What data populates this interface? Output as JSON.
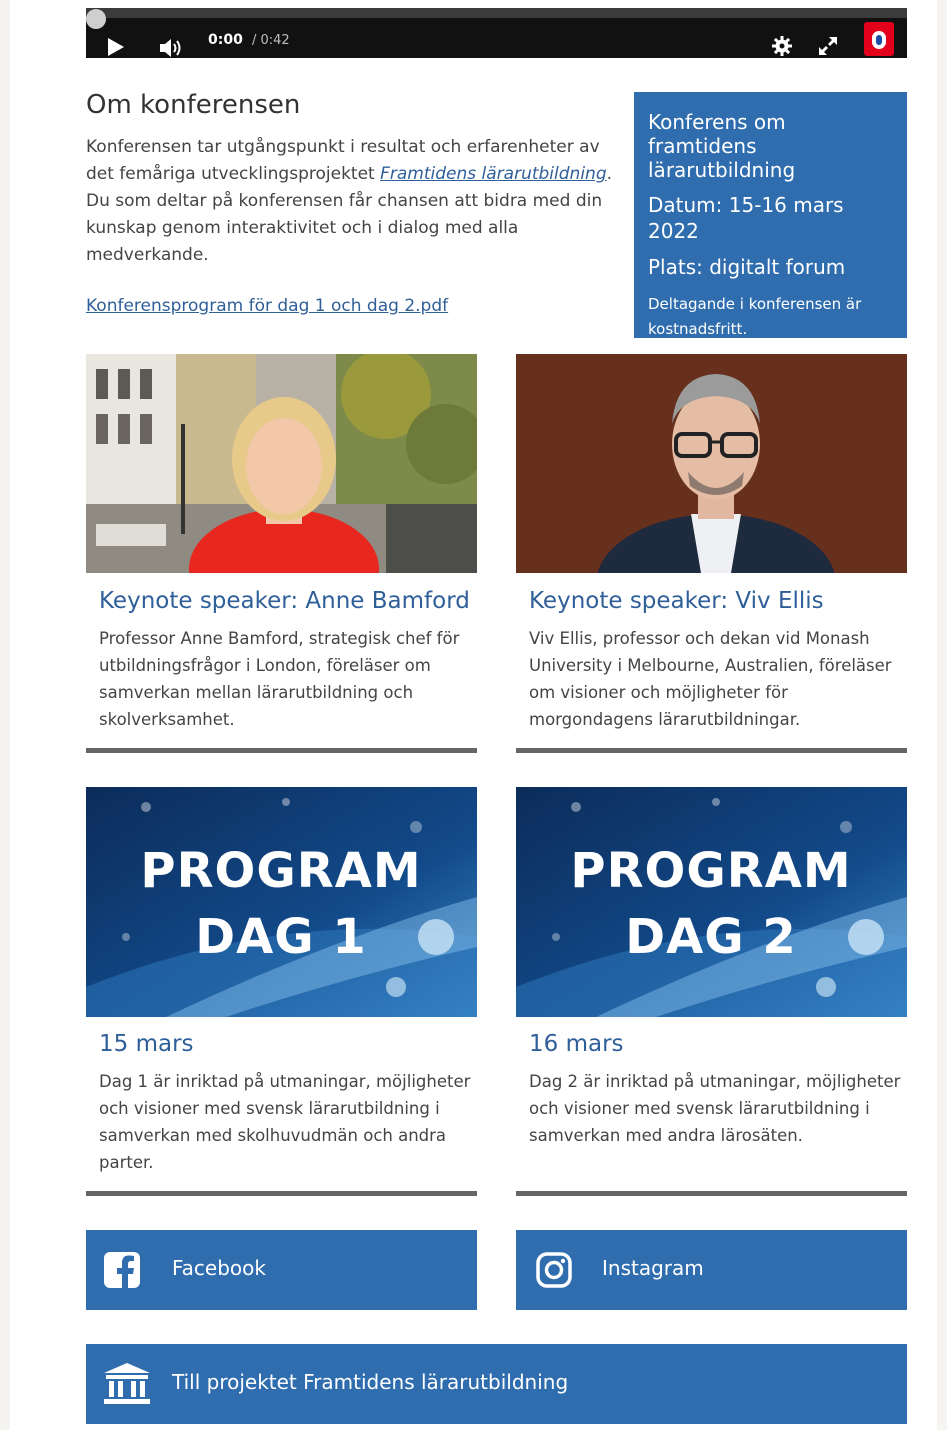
{
  "player": {
    "current_time": "0:00",
    "duration": "/ 0:42",
    "progress": 0
  },
  "about": {
    "heading": "Om konferensen",
    "text_before_link": "Konferensen tar utgångspunkt i resultat och erfarenheter av det femåriga utvecklingsprojektet ",
    "project_link": "Framtidens lärarutbildning",
    "text_after_link": ". Du som deltar på konferensen får chansen att bidra med din kunskap genom interaktivitet och i dialog med alla medverkande.",
    "program_pdf_link": "Konferensprogram för dag 1 och dag 2.pdf"
  },
  "infobox": {
    "title": "Konferens om framtidens lärarutbildning",
    "date": "Datum: 15-16 mars 2022",
    "place": "Plats: digitalt forum",
    "note": "Deltagande i konferensen är kostnadsfritt."
  },
  "speakers": [
    {
      "title": "Keynote speaker: Anne Bamford",
      "body": "Professor Anne Bamford, strategisk chef för utbildningsfrågor i London, föreläser om samverkan mellan lärarutbildning och skolverksamhet."
    },
    {
      "title": "Keynote speaker: Viv Ellis",
      "body": "Viv Ellis, professor och dekan vid Monash University i Melbourne, Australien, föreläser om visioner och möjligheter för morgondagens lärarutbildningar."
    }
  ],
  "programs": [
    {
      "banner_line1": "PROGRAM",
      "banner_line2": "DAG 1",
      "date": "15 mars",
      "body": "Dag 1 är inriktad på utmaningar, möjligheter och visioner med svensk lärarutbildning i samverkan med skolhuvudmän och andra parter."
    },
    {
      "banner_line1": "PROGRAM",
      "banner_line2": "DAG 2",
      "date": "16 mars",
      "body": "Dag 2 är inriktad på utmaningar, möjligheter och visioner med svensk lärarutbildning i samverkan med andra lärosäten."
    }
  ],
  "social": {
    "facebook_label": "Facebook",
    "facebook_icon": "facebook-icon",
    "instagram_label": "Instagram",
    "instagram_icon": "instagram-icon"
  },
  "project_button": {
    "label": "Till projektet Framtidens lärarutbildning",
    "icon": "institution-icon"
  },
  "colors": {
    "accent_blue": "#2f6daf",
    "link_blue": "#2f5f99",
    "card_border": "#666666"
  }
}
